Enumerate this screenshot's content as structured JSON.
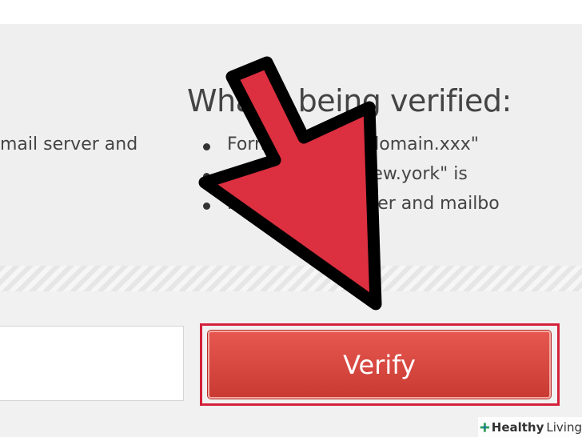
{
  "left_section": {
    "text_fragment": "mail server and"
  },
  "info": {
    "heading": "What's being verified:",
    "bullets": [
      "Format: name@domain.xxx\"",
      "...\"somebody@new.york\" is",
      "Mailbox: if the user and mailbo"
    ]
  },
  "form": {
    "email_value": "",
    "verify_label": "Verify"
  },
  "annotation": {
    "arrow_color": "#dc2f40",
    "highlight_color": "#d4213a"
  },
  "watermark": {
    "brand": "Healthy",
    "brand2": "Living"
  },
  "colors": {
    "button": "#d9473f",
    "panel": "#efefef"
  }
}
